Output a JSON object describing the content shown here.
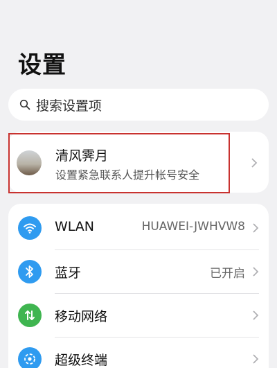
{
  "header": {
    "title": "设置"
  },
  "search": {
    "placeholder": "搜索设置项",
    "icon": "search-icon"
  },
  "account": {
    "name": "清风霁月",
    "subtitle": "设置紧急联系人提升帐号安全"
  },
  "settings": [
    {
      "label": "WLAN",
      "value": "HUAWEI-JWHVW8",
      "icon": "wifi-icon",
      "color": "#2f9bf0"
    },
    {
      "label": "蓝牙",
      "value": "已开启",
      "icon": "bluetooth-icon",
      "color": "#2f9bf0"
    },
    {
      "label": "移动网络",
      "value": "",
      "icon": "mobile-network-icon",
      "color": "#3fb550"
    },
    {
      "label": "超级终端",
      "value": "",
      "icon": "super-device-icon",
      "color": "#2f9bf0"
    }
  ],
  "colors": {
    "highlight_border": "#c8322f",
    "background": "#f1f1f3"
  }
}
